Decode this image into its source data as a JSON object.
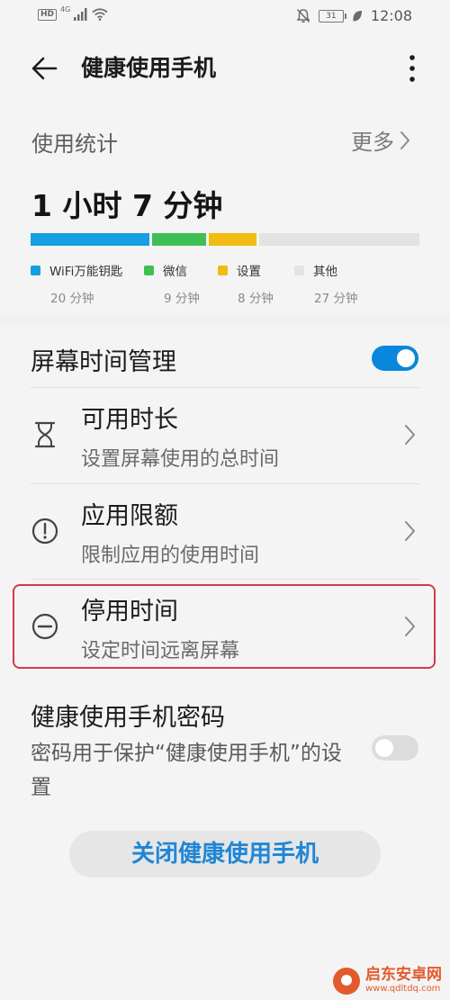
{
  "status_bar": {
    "network_badge": "HD",
    "network_type": "4G",
    "battery": "31",
    "time": "12:08",
    "icons": [
      "signal-icon",
      "wifi-icon",
      "mute-icon",
      "battery-icon",
      "leaf-icon"
    ]
  },
  "header": {
    "title": "健康使用手机"
  },
  "usage": {
    "heading": "使用统计",
    "more_label": "更多",
    "total_time": "1 小时 7 分钟",
    "apps": [
      {
        "name": "WiFi万能钥匙",
        "value": "20 分钟",
        "minutes": 20,
        "color": "#149fe3"
      },
      {
        "name": "微信",
        "value": "9 分钟",
        "minutes": 9,
        "color": "#3fbf53"
      },
      {
        "name": "设置",
        "value": "8 分钟",
        "minutes": 8,
        "color": "#f1bc12"
      },
      {
        "name": "其他",
        "value": "27 分钟",
        "minutes": 27,
        "color": "#e3e3e3"
      }
    ]
  },
  "screen_time": {
    "title": "屏幕时间管理",
    "enabled": true,
    "items": [
      {
        "title": "可用时长",
        "subtitle": "设置屏幕使用的总时间",
        "icon": "hourglass-icon"
      },
      {
        "title": "应用限额",
        "subtitle": "限制应用的使用时间",
        "icon": "alert-circle-icon"
      },
      {
        "title": "停用时间",
        "subtitle": "设定时间远离屏幕",
        "icon": "minus-circle-icon"
      }
    ]
  },
  "password": {
    "title": "健康使用手机密码",
    "description": "密码用于保护“健康使用手机”的设置",
    "enabled": false
  },
  "close_button": {
    "label": "关闭健康使用手机"
  },
  "watermark": {
    "text": "启东安卓网",
    "url": "www.qdltdq.com"
  },
  "colors": {
    "accent": "#0a86dc",
    "highlight": "#d33a46"
  }
}
